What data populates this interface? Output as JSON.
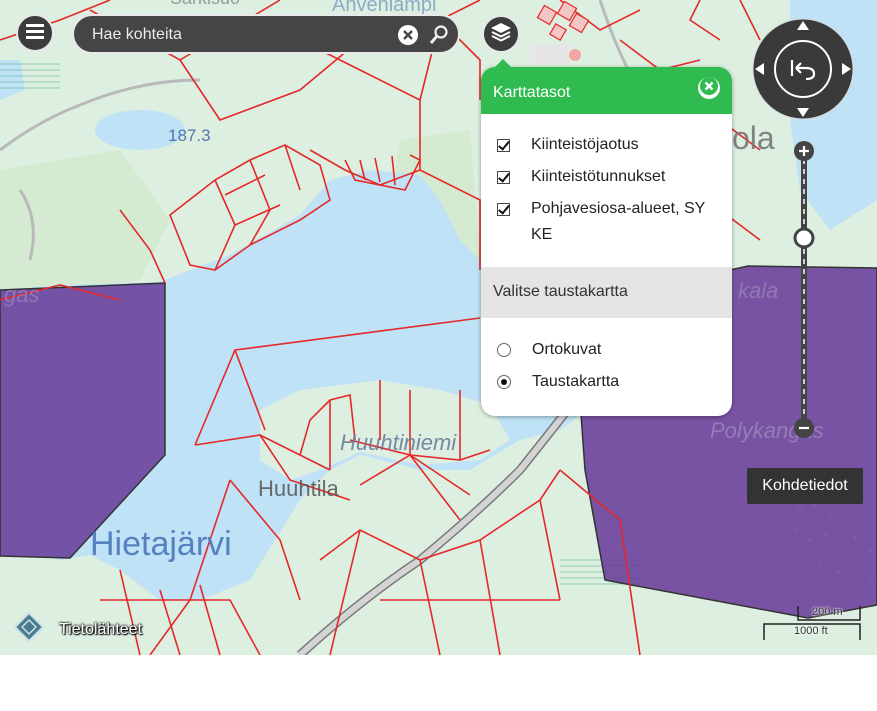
{
  "search": {
    "placeholder": "Hae kohteita"
  },
  "layers_panel": {
    "title": "Karttatasot",
    "layers": [
      {
        "label": "Kiinteistöjaotus",
        "checked": true
      },
      {
        "label": "Kiinteistötunnukset",
        "checked": true
      },
      {
        "label": "Pohjavesiosa-alueet, SYKE",
        "checked": true
      }
    ],
    "background_title": "Valitse taustakartta",
    "backgrounds": [
      {
        "label": "Ortokuvat",
        "selected": false
      },
      {
        "label": "Taustakartta",
        "selected": true
      }
    ]
  },
  "map_labels": {
    "hietajarvi": "Hietajärvi",
    "huuhtila": "Huuhtila",
    "huuhtiniemi": "Huuhtiniemi",
    "elevation": "187.3",
    "pohja": "Polykangas",
    "ola": "ola",
    "sarkisuo": "Sarkisuo",
    "ahvenlampi": "Ahvenlampi",
    "gas": "gas",
    "kala": "kala"
  },
  "feature_info_button": "Kohdetiedot",
  "data_sources_label": "Tietolähteet",
  "scale": {
    "metric": "200 m",
    "imperial": "1000 ft"
  },
  "icons": {
    "menu": "menu-icon",
    "layers": "layers-icon",
    "clear": "clear-icon",
    "search": "search-icon",
    "compass": "compass-reset-icon",
    "sources": "data-sources-icon"
  },
  "colors": {
    "water": "#bfe2f6",
    "land": "#dff0e2",
    "parcel_lines": "#e52828",
    "groundwater_area": "#6a3d9a",
    "panel_accent": "#2fbb4f"
  }
}
